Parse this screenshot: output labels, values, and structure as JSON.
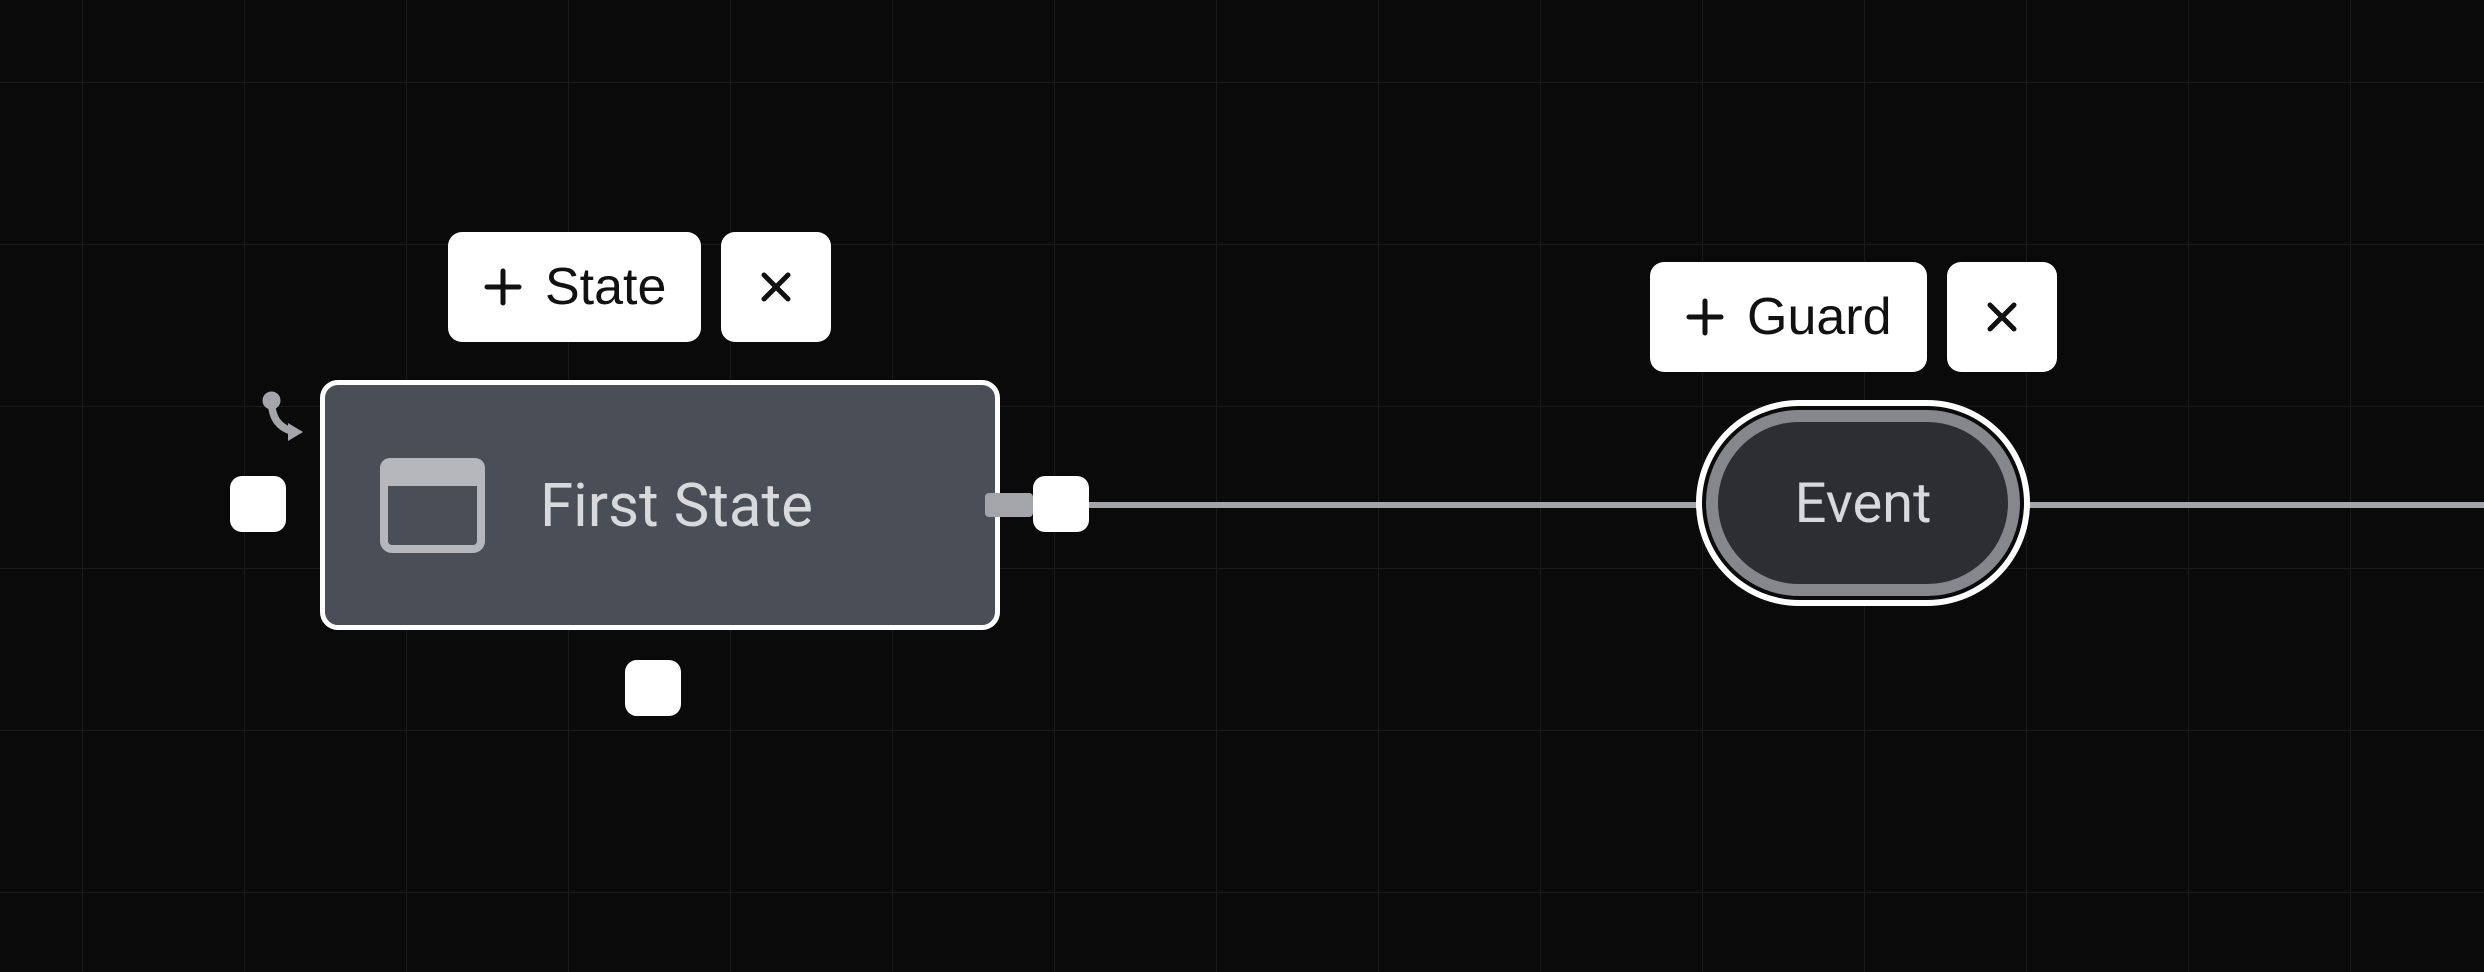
{
  "state": {
    "label": "First State",
    "add_button_label": "State"
  },
  "event": {
    "label": "Event",
    "add_button_label": "Guard"
  }
}
